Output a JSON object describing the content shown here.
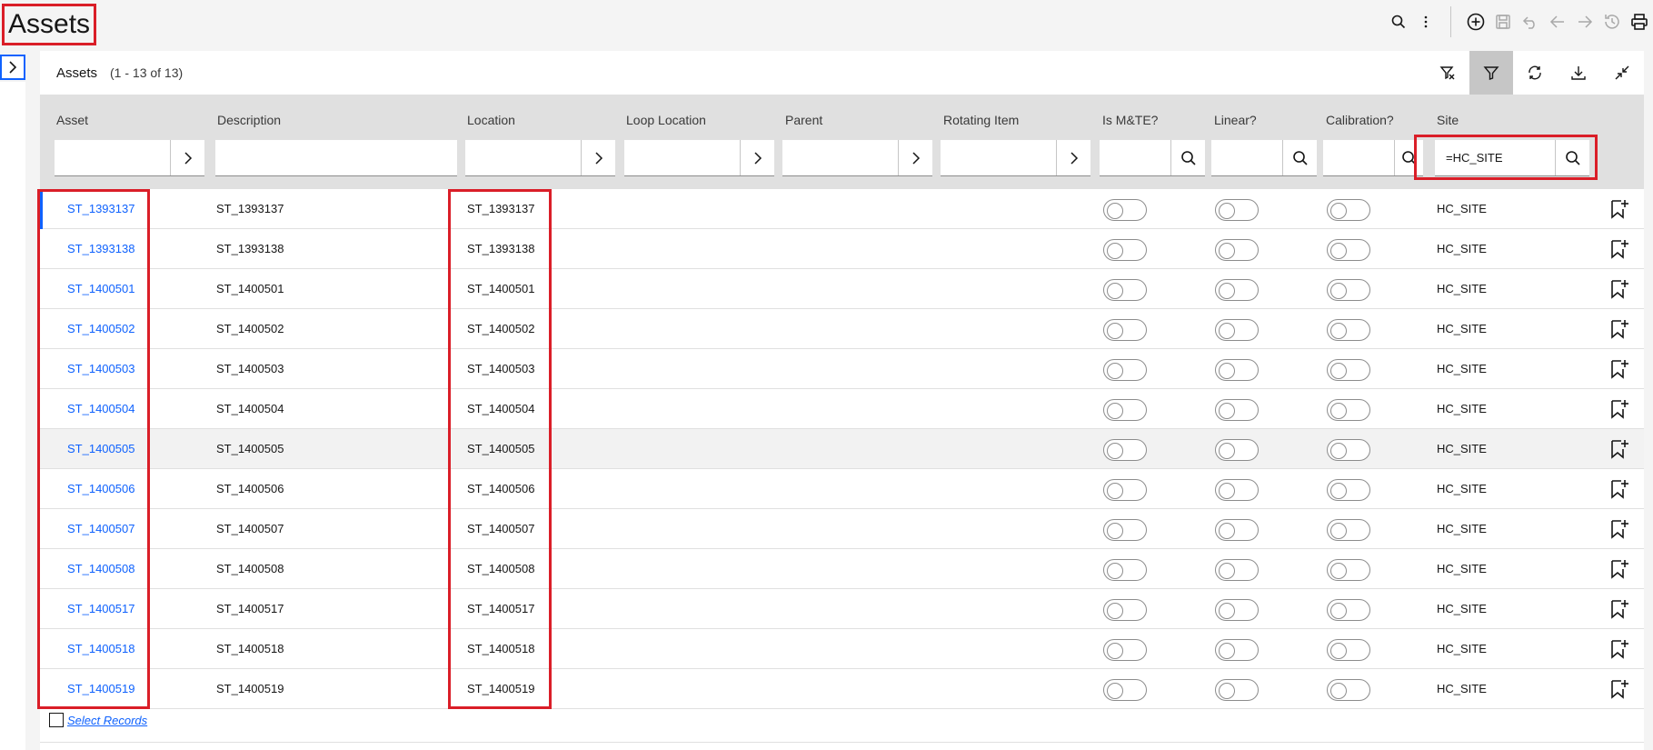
{
  "page": {
    "title": "Assets"
  },
  "toolbar": {
    "icons": [
      "search-icon",
      "overflow-menu-icon",
      "add-icon",
      "save-icon",
      "undo-icon",
      "back-icon",
      "forward-icon",
      "history-icon",
      "print-icon"
    ]
  },
  "table": {
    "title": "Assets",
    "count": "(1 - 13 of 13)",
    "actions": [
      "clear-filter-icon",
      "filter-icon",
      "refresh-icon",
      "download-icon",
      "collapse-icon"
    ],
    "columns": [
      {
        "key": "asset",
        "label": "Asset",
        "filter": ""
      },
      {
        "key": "description",
        "label": "Description",
        "filter": ""
      },
      {
        "key": "location",
        "label": "Location",
        "filter": ""
      },
      {
        "key": "loop_location",
        "label": "Loop Location",
        "filter": ""
      },
      {
        "key": "parent",
        "label": "Parent",
        "filter": ""
      },
      {
        "key": "rotating_item",
        "label": "Rotating Item",
        "filter": ""
      },
      {
        "key": "is_mte",
        "label": "Is M&TE?",
        "filter": ""
      },
      {
        "key": "linear",
        "label": "Linear?",
        "filter": ""
      },
      {
        "key": "calibration",
        "label": "Calibration?",
        "filter": ""
      },
      {
        "key": "site",
        "label": "Site",
        "filter": "=HC_SITE"
      }
    ],
    "rows": [
      {
        "asset": "ST_1393137",
        "description": "ST_1393137",
        "location": "ST_1393137",
        "site": "HC_SITE"
      },
      {
        "asset": "ST_1393138",
        "description": "ST_1393138",
        "location": "ST_1393138",
        "site": "HC_SITE"
      },
      {
        "asset": "ST_1400501",
        "description": "ST_1400501",
        "location": "ST_1400501",
        "site": "HC_SITE"
      },
      {
        "asset": "ST_1400502",
        "description": "ST_1400502",
        "location": "ST_1400502",
        "site": "HC_SITE"
      },
      {
        "asset": "ST_1400503",
        "description": "ST_1400503",
        "location": "ST_1400503",
        "site": "HC_SITE"
      },
      {
        "asset": "ST_1400504",
        "description": "ST_1400504",
        "location": "ST_1400504",
        "site": "HC_SITE"
      },
      {
        "asset": "ST_1400505",
        "description": "ST_1400505",
        "location": "ST_1400505",
        "site": "HC_SITE"
      },
      {
        "asset": "ST_1400506",
        "description": "ST_1400506",
        "location": "ST_1400506",
        "site": "HC_SITE"
      },
      {
        "asset": "ST_1400507",
        "description": "ST_1400507",
        "location": "ST_1400507",
        "site": "HC_SITE"
      },
      {
        "asset": "ST_1400508",
        "description": "ST_1400508",
        "location": "ST_1400508",
        "site": "HC_SITE"
      },
      {
        "asset": "ST_1400517",
        "description": "ST_1400517",
        "location": "ST_1400517",
        "site": "HC_SITE"
      },
      {
        "asset": "ST_1400518",
        "description": "ST_1400518",
        "location": "ST_1400518",
        "site": "HC_SITE"
      },
      {
        "asset": "ST_1400519",
        "description": "ST_1400519",
        "location": "ST_1400519",
        "site": "HC_SITE"
      }
    ],
    "select_records": "Select Records"
  },
  "colors": {
    "link": "#0f62fe",
    "highlight": "#da1e28",
    "filter_bg": "#e0e0e0"
  }
}
